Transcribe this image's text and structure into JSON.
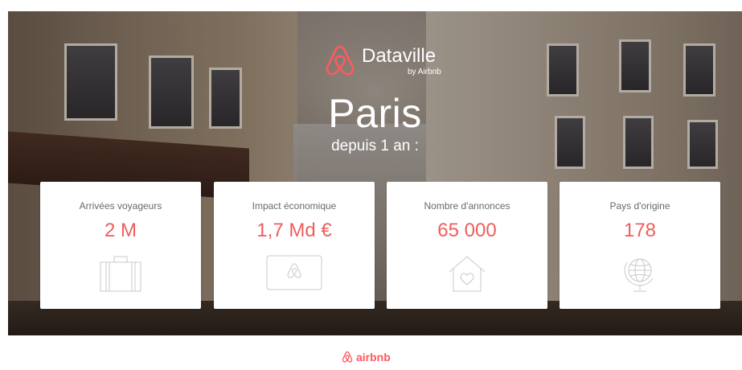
{
  "brand": {
    "name": "Dataville",
    "subtitle": "by Airbnb",
    "accent_color": "#ff5a5f",
    "value_color": "#ee5e5e"
  },
  "hero": {
    "city": "Paris",
    "period": "depuis 1 an :"
  },
  "stats": [
    {
      "label": "Arrivées voyageurs",
      "value": "2 M",
      "icon": "suitcase-icon"
    },
    {
      "label": "Impact économique",
      "value": "1,7 Md €",
      "icon": "airbnb-card-icon"
    },
    {
      "label": "Nombre d'annonces",
      "value": "65 000",
      "icon": "house-heart-icon"
    },
    {
      "label": "Pays d'origine",
      "value": "178",
      "icon": "globe-icon"
    }
  ],
  "footer": {
    "logo_text": "airbnb"
  }
}
